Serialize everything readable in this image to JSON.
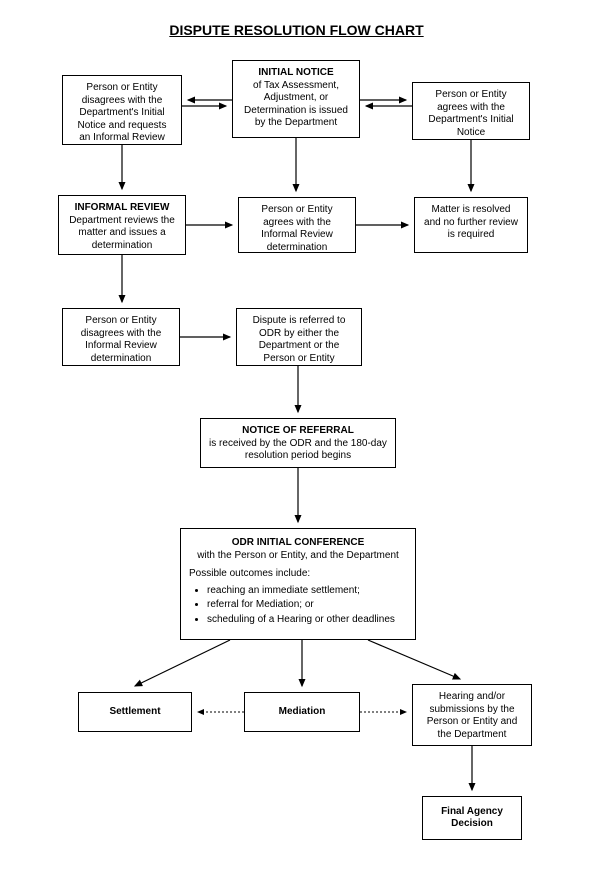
{
  "title": "DISPUTE RESOLUTION FLOW CHART",
  "boxes": {
    "initial_notice": {
      "heading": "INITIAL NOTICE",
      "body": "of Tax Assessment, Adjustment, or Determination is issued by the Department"
    },
    "disagree_initial": {
      "body1": "Person or Entity disagrees with the Department's Initial Notice and requests an Informal Review"
    },
    "agree_initial": {
      "body1": "Person or Entity agrees with the Department's Initial Notice"
    },
    "informal_review": {
      "heading": "INFORMAL REVIEW",
      "body": "Department reviews the matter and issues a determination"
    },
    "agree_informal": {
      "body1": "Person or Entity agrees with the Informal Review determination"
    },
    "resolved": {
      "body1": "Matter is resolved and no further review is required"
    },
    "disagree_informal": {
      "body1": "Person or Entity disagrees with the Informal Review determination"
    },
    "referred_odr": {
      "body1": "Dispute is referred to ODR by either the Department or the Person or Entity"
    },
    "notice_referral": {
      "heading": "NOTICE OF REFERRAL",
      "body": "is received by the ODR and the 180-day resolution period begins"
    },
    "odr_conf": {
      "heading": "ODR INITIAL CONFERENCE",
      "body": "with the Person or Entity, and the Department",
      "possible_label": "Possible outcomes include:",
      "bullets": [
        "reaching an immediate settlement;",
        "referral for Mediation; or",
        "scheduling of a Hearing or other deadlines"
      ]
    },
    "settlement": {
      "label": "Settlement"
    },
    "mediation": {
      "label": "Mediation"
    },
    "hearing": {
      "body1": "Hearing and/or submissions by the Person or Entity and the Department"
    },
    "final_decision": {
      "label": "Final Agency Decision"
    }
  }
}
